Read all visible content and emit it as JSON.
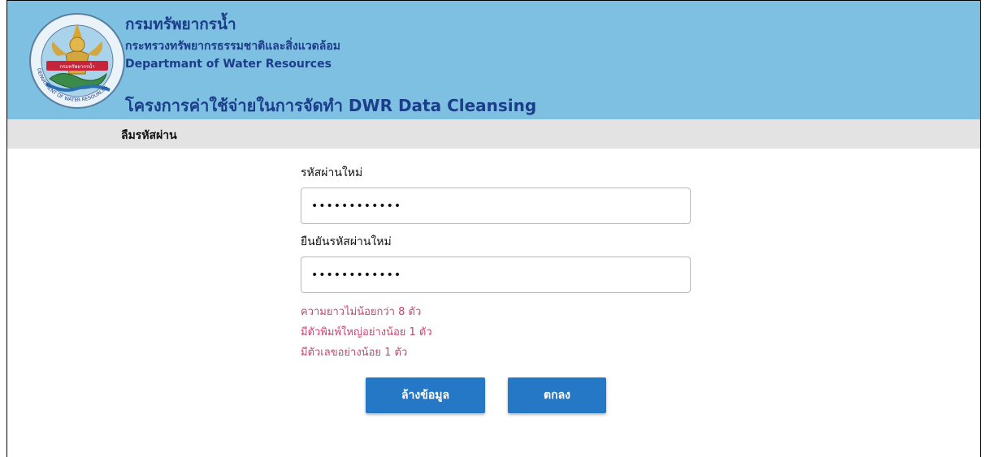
{
  "header": {
    "org_th": "กรมทรัพยากรน้ำ",
    "ministry": "กระทรวงทรัพยากรธรรมชาติและสิ่งแวดล้อม",
    "org_en": "Departmant of Water Resources",
    "project": "โครงการค่าใช้จ่ายในการจัดทำ DWR Data Cleansing",
    "logo_ring_text": "DEPARTMENT OF WATER RESOURCES",
    "logo_banner_text": "กรมทรัพยากรน้ำ"
  },
  "subbar": {
    "title": "ลืมรหัสผ่าน"
  },
  "form": {
    "new_password_label": "รหัสผ่านใหม่",
    "new_password_value": "••••••••••••",
    "confirm_password_label": "ยืนยันรหัสผ่านใหม่",
    "confirm_password_value": "••••••••••••",
    "rules": [
      "ความยาวไม่น้อยกว่า 8 ตัว",
      "มีตัวพิมพ์ใหญ่อย่างน้อย 1 ตัว",
      "มีตัวเลขอย่างน้อย 1 ตัว"
    ],
    "clear_button": "ล้างข้อมูล",
    "ok_button": "ตกลง"
  },
  "colors": {
    "header_bg": "#7ec0e2",
    "header_text": "#1c3d8a",
    "subbar_bg": "#e3e3e3",
    "rule_text": "#c4456f",
    "button_bg": "#2478c6"
  },
  "icons": {
    "logo": "dwr-emblem-icon"
  }
}
